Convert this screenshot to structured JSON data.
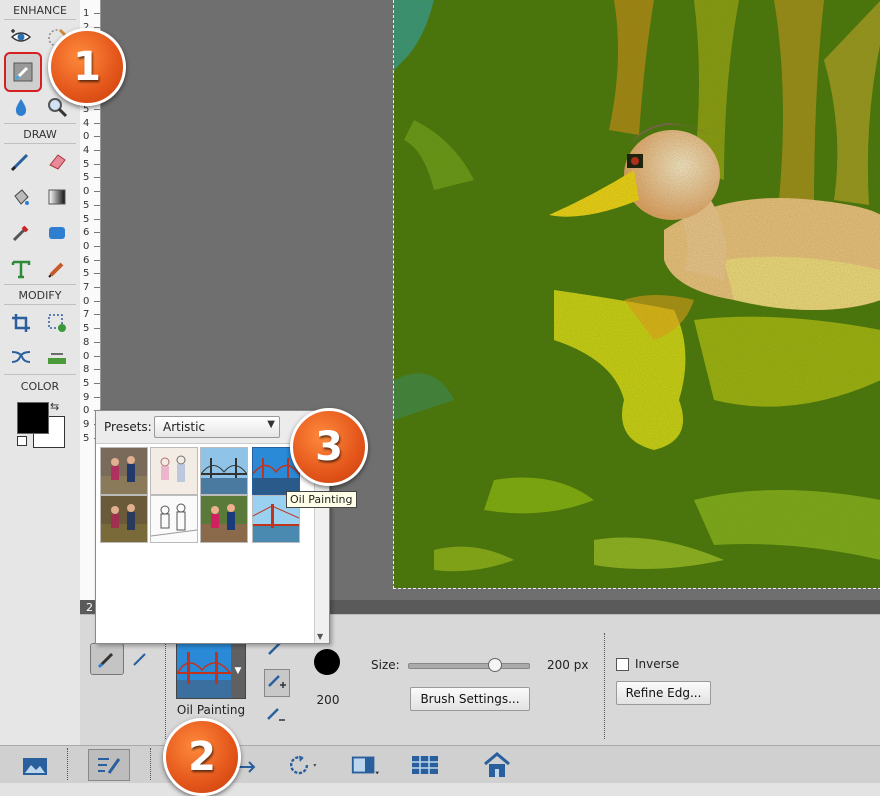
{
  "toolbox": {
    "sections": {
      "enhance": "ENHANCE",
      "draw": "DRAW",
      "modify": "MODIFY",
      "color": "COLOR"
    },
    "foreground_color": "#000000",
    "background_color": "#ffffff"
  },
  "ruler": {
    "ticks": [
      "1",
      "2",
      "2",
      "5",
      "3",
      "0",
      "3",
      "5",
      "4",
      "0",
      "4",
      "5",
      "5",
      "0",
      "5",
      "5",
      "6",
      "0",
      "6",
      "5",
      "7",
      "0",
      "7",
      "5",
      "8",
      "0",
      "8",
      "5",
      "9",
      "0",
      "9",
      "5"
    ]
  },
  "presets_panel": {
    "label": "Presets:",
    "selected": "Artistic",
    "tooltip": "Oil Painting"
  },
  "options_bar": {
    "preset_name": "Oil Painting",
    "size_label": "Size:",
    "size_value": "200 px",
    "size_level_fraction": 0.72,
    "brush_preview_value": "200",
    "brush_settings_button": "Brush Settings...",
    "inverse_label": "Inverse",
    "refine_edge_button": "Refine Edg...",
    "scroll_number": "2"
  },
  "callouts": {
    "one": "1",
    "two": "2",
    "three": "3"
  },
  "colors": {
    "callout_orange": "#e3551a",
    "highlight_red": "#d42020"
  }
}
